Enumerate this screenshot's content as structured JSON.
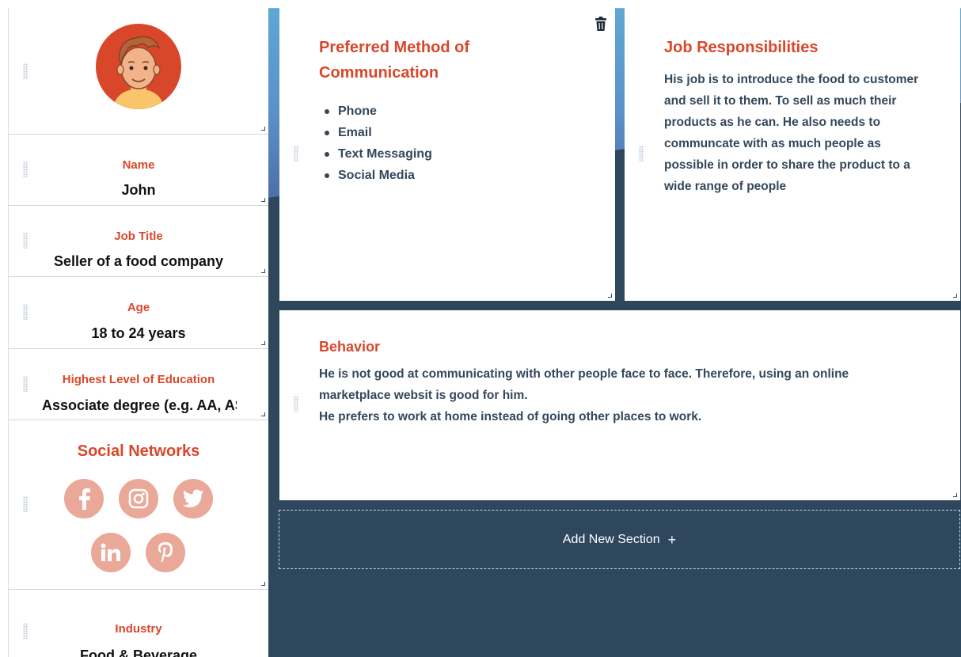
{
  "profile": {
    "avatar_icon": "person-avatar-icon",
    "fields": [
      {
        "label": "Name",
        "value": "John"
      },
      {
        "label": "Job Title",
        "value": "Seller of a food company"
      },
      {
        "label": "Age",
        "value": "18 to 24 years"
      },
      {
        "label": "Highest Level of Education",
        "value": "Associate degree (e.g. AA, AS)"
      },
      {
        "label": "Industry",
        "value": "Food & Beverage"
      }
    ],
    "social": {
      "title": "Social Networks",
      "icons": [
        "facebook-icon",
        "instagram-icon",
        "twitter-icon",
        "linkedin-icon",
        "pinterest-icon"
      ]
    }
  },
  "communication": {
    "title": "Preferred Method of Communication",
    "items": [
      "Phone",
      "Email",
      "Text Messaging",
      "Social Media"
    ]
  },
  "responsibilities": {
    "title": "Job Responsibilities",
    "text": "His job is to introduce the food to customer and sell it to them. To sell as much their products as he can. He also needs to communcate with as much people as possible in order to share the product to a wide range of people"
  },
  "behavior": {
    "title": "Behavior",
    "lines": [
      "He is not good at communicating with other people face to face. Therefore, using an online marketplace websit is good for him.",
      "He prefers to work at home instead of going other places to work."
    ]
  },
  "add_section": {
    "label": "Add New Section",
    "icon": "plus-icon"
  },
  "colors": {
    "accent": "#d9472b",
    "text": "#33475b",
    "canvas": "#2e475d",
    "social": "#eaa898"
  }
}
